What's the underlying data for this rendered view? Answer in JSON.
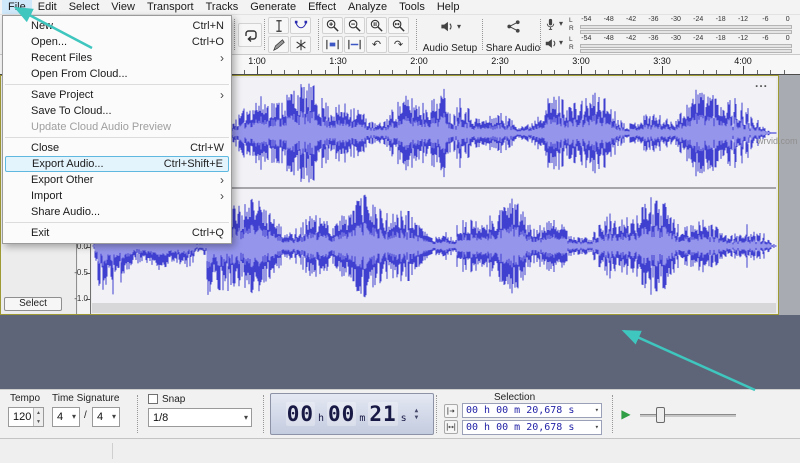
{
  "colors": {
    "accent_arrow": "#3fc6bf",
    "waveform_outer": "#3f3fd0",
    "waveform_inner": "#9595ec",
    "menu_highlight_bg": "#e4f4fd",
    "menu_highlight_border": "#5fb8e0"
  },
  "icons": {
    "caret_down": "▾",
    "spinner_up": "▲",
    "spinner_down": "▼",
    "submenu_arrow": "›",
    "undo": "↶",
    "redo": "↷",
    "play": "▶"
  },
  "menu_bar": {
    "items": [
      "File",
      "Edit",
      "Select",
      "View",
      "Transport",
      "Tracks",
      "Generate",
      "Effect",
      "Analyze",
      "Tools",
      "Help"
    ]
  },
  "file_menu": {
    "items": [
      {
        "label": "New",
        "shortcut": "Ctrl+N"
      },
      {
        "label": "Open...",
        "shortcut": "Ctrl+O"
      },
      {
        "label": "Recent Files",
        "submenu": true
      },
      {
        "label": "Open From Cloud..."
      },
      {
        "separator": true
      },
      {
        "label": "Save Project",
        "submenu": true
      },
      {
        "label": "Save To Cloud..."
      },
      {
        "label": "Update Cloud Audio Preview",
        "disabled": true
      },
      {
        "separator": true
      },
      {
        "label": "Close",
        "shortcut": "Ctrl+W"
      },
      {
        "label": "Export Audio...",
        "shortcut": "Ctrl+Shift+E",
        "highlighted": true
      },
      {
        "label": "Export Other",
        "submenu": true
      },
      {
        "label": "Import",
        "submenu": true
      },
      {
        "label": "Share Audio..."
      },
      {
        "separator": true
      },
      {
        "label": "Exit",
        "shortcut": "Ctrl+Q"
      }
    ]
  },
  "toolbar": {
    "audio_setup_label": "Audio Setup",
    "share_audio_label": "Share Audio",
    "meter_ticks": [
      "-54",
      "-48",
      "-42",
      "-36",
      "-30",
      "-24",
      "-18",
      "-12",
      "-6",
      "0"
    ],
    "channel_labels": [
      "L",
      "R"
    ]
  },
  "timeline": {
    "labels": [
      "1:00",
      "1:30",
      "2:00",
      "2:30",
      "3:00",
      "3:30",
      "4:00"
    ]
  },
  "track": {
    "ruler_labels": [
      "0.0",
      "-0.5",
      "-1.0"
    ],
    "select_button_label": "Select",
    "overflow_label": "..."
  },
  "transport_bottom": {
    "tempo_label": "Tempo",
    "tempo_value": "120",
    "time_sig_label": "Time Signature",
    "time_sig_top": "4",
    "slash": "/",
    "time_sig_bottom": "4",
    "snap_label": "Snap",
    "snap_value": "1/8",
    "time_display": {
      "h": "00",
      "unit_h": "h",
      "m": "00",
      "unit_m": "m",
      "s": "21",
      "unit_s": "s"
    },
    "selection_label": "Selection",
    "selection_values": [
      "00 h 00 m 20,678 s",
      "00 h 00 m 20,678 s"
    ]
  },
  "watermark": "wrvid.com"
}
